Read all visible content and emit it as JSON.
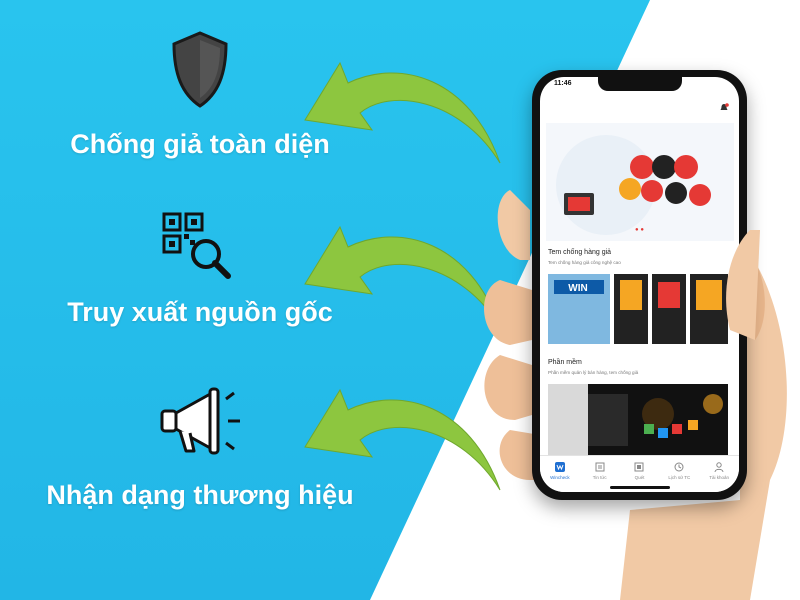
{
  "features": [
    {
      "label": "Chống giả toàn diện",
      "icon": "shield-icon"
    },
    {
      "label": "Truy xuất nguồn gốc",
      "icon": "qr-search-icon"
    },
    {
      "label": "Nhận dạng thương hiệu",
      "icon": "megaphone-icon"
    }
  ],
  "colors": {
    "background_blue": "#29c4ee",
    "arrow_green": "#8dc63f",
    "label": "#ffffff"
  },
  "phone": {
    "time": "11:46",
    "section1": {
      "title": "Tem chống hàng giả",
      "subtitle": "Tem chống hàng giả công nghệ cao"
    },
    "section2": {
      "title": "Phần mềm",
      "subtitle": "Phần mềm quản lý bán hàng, tem chống giả"
    },
    "banner_tile_text": "WIN",
    "tabs": [
      {
        "label": "Wincheck",
        "icon": "logo-icon"
      },
      {
        "label": "Tin tức",
        "icon": "news-icon"
      },
      {
        "label": "Quét",
        "icon": "scan-icon"
      },
      {
        "label": "Lịch sử TC",
        "icon": "history-icon"
      },
      {
        "label": "Tài khoản",
        "icon": "user-icon"
      }
    ]
  }
}
